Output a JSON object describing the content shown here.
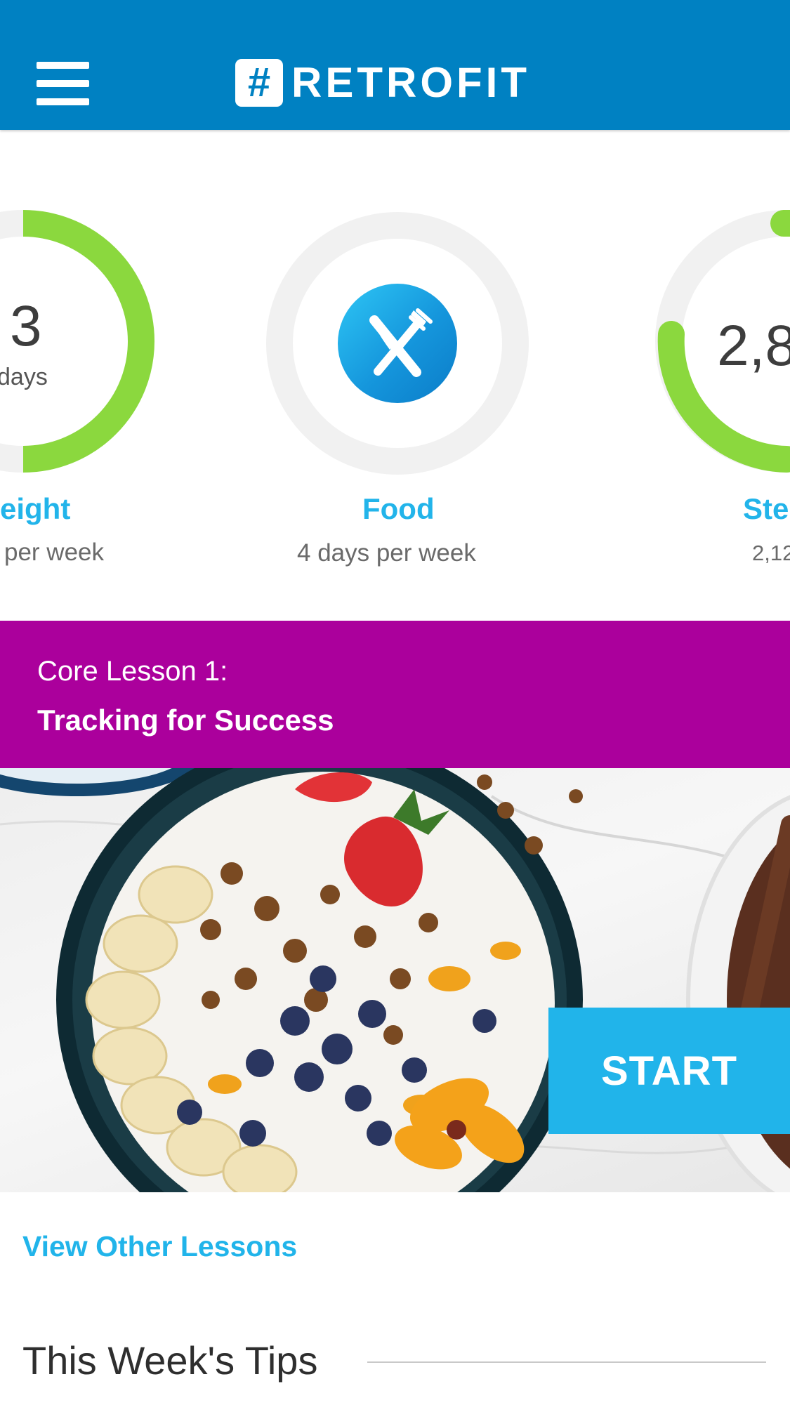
{
  "header": {
    "logo_mark": "#",
    "logo_text": "RETROFIT",
    "menu_icon": "hamburger-menu-icon"
  },
  "metrics": [
    {
      "value": "3",
      "unit": "days",
      "title": "eight",
      "subtitle": "per week",
      "progress": 0.75,
      "ring_color": "#8bd83e"
    },
    {
      "icon": "fork-knife-icon",
      "title": "Food",
      "subtitle": "4 days per week",
      "progress": 0,
      "icon_color": "#21b4ea"
    },
    {
      "value": "2,8",
      "title": "Ste",
      "subtitle": "2,12",
      "progress": 0.55,
      "ring_color": "#8bd83e"
    }
  ],
  "lesson": {
    "kicker": "Core Lesson 1:",
    "title": "Tracking for Success",
    "banner_color": "#ab009c",
    "start_label": "START"
  },
  "links": {
    "view_other_lessons": "View Other Lessons"
  },
  "tips": {
    "heading": "This Week's Tips"
  },
  "colors": {
    "header": "#0081c2",
    "accent": "#21b4ea",
    "ring_track": "#f1f1f1",
    "ring_progress": "#8bd83e"
  }
}
